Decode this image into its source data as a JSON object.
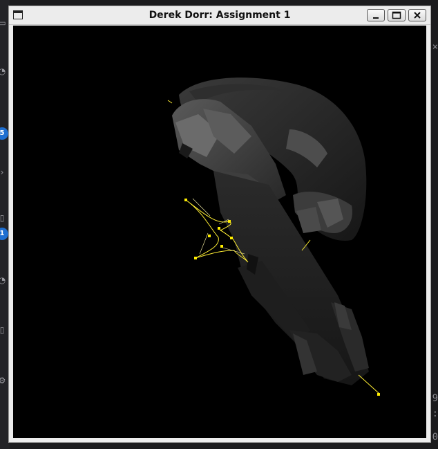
{
  "window": {
    "title": "Derek Dorr: Assignment 1",
    "icon": "window-icon",
    "controls": [
      "minimize-icon",
      "maximize-icon",
      "close-icon"
    ]
  },
  "background_app": {
    "left_badges": [
      "5",
      "1"
    ],
    "left_icons": [
      "home-icon",
      "history-icon",
      "chevron-right-icon",
      "file-icon",
      "history-icon",
      "file-icon",
      "gear-icon"
    ],
    "right_glyphs": [
      "×",
      "9",
      ":",
      "0"
    ]
  },
  "scene": {
    "background_color": "#000000",
    "spline_color": "#ffee33",
    "control_point_color": "#ffee00"
  }
}
